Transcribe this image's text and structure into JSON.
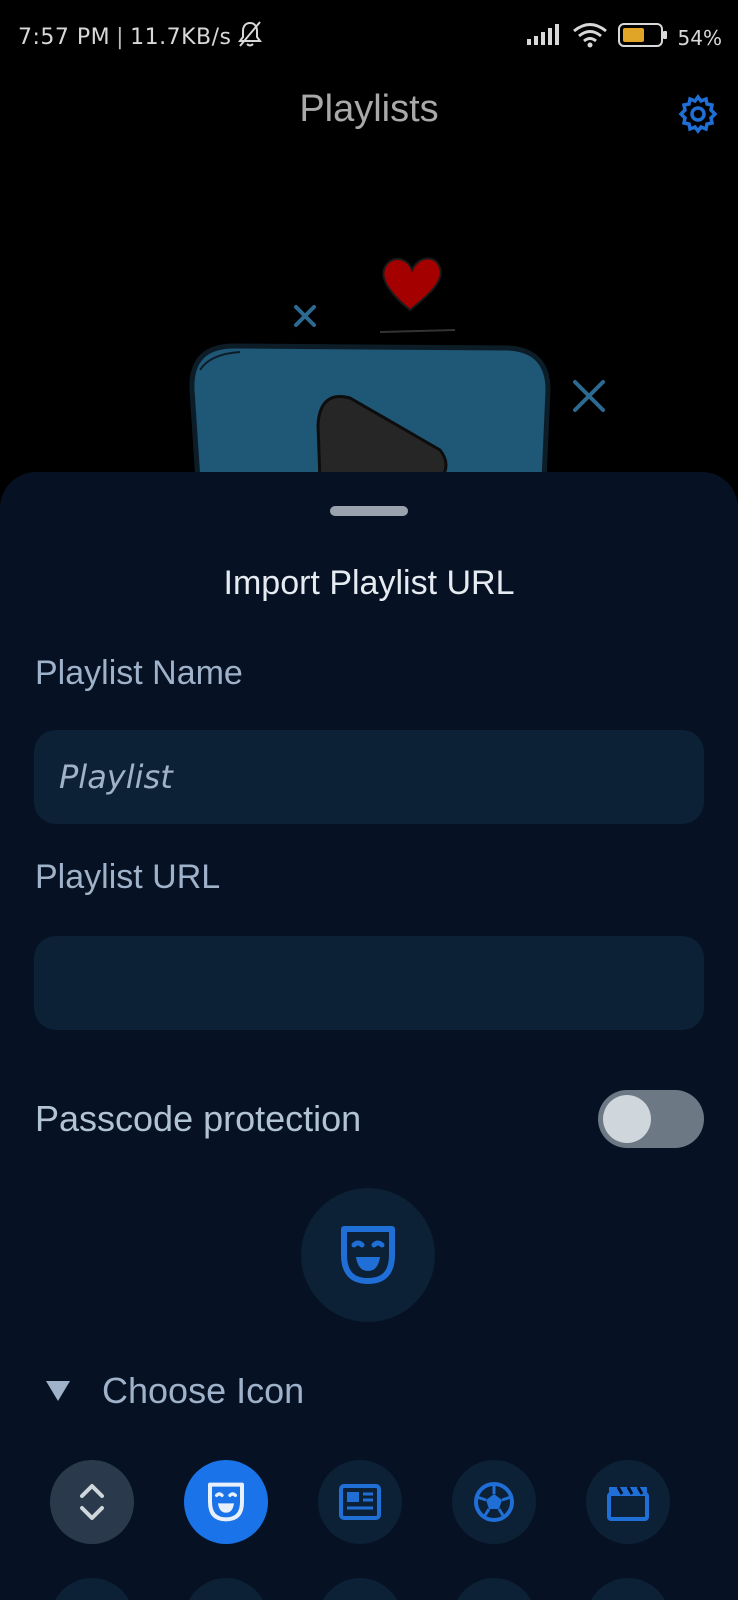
{
  "status_bar": {
    "time": "7:57 PM",
    "speed": "11.7KB/s",
    "battery": "54%"
  },
  "app_bar": {
    "title": "Playlists"
  },
  "sheet": {
    "title": "Import Playlist URL",
    "name_label": "Playlist Name",
    "name_value": "Playlist",
    "url_label": "Playlist URL",
    "url_value": "",
    "passcode_label": "Passcode protection",
    "passcode_enabled": false,
    "selected_icon": "theater-mask-icon",
    "choose_icon_label": "Choose Icon",
    "icon_options": [
      "sort-icon",
      "theater-mask-icon",
      "newspaper-icon",
      "soccer-ball-icon",
      "movie-clapper-icon"
    ],
    "selected_option_index": 1
  },
  "colors": {
    "background": "#000000",
    "sheet": "#061223",
    "field": "#0c2036",
    "accent": "#1a73e8",
    "icon_blue": "#1f6fd6"
  }
}
